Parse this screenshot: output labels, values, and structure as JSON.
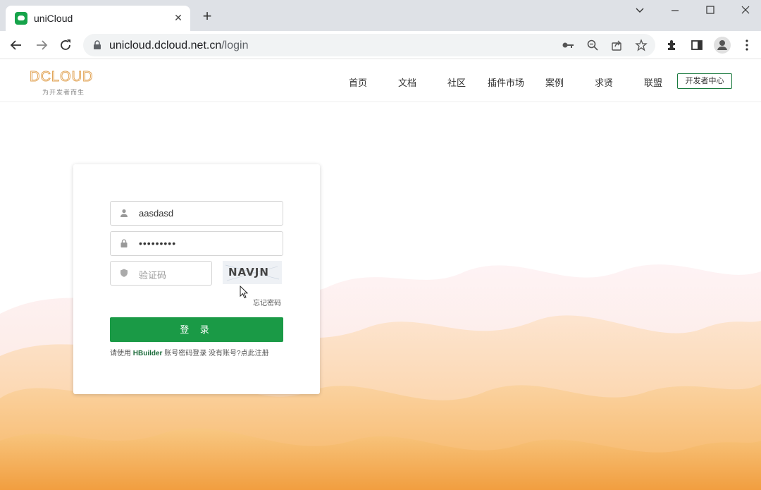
{
  "browser": {
    "tab_title": "uniCloud",
    "tab_close": "✕",
    "new_tab": "+",
    "url_host": "unicloud.dcloud.net.cn",
    "url_path": "/login"
  },
  "header": {
    "logo_text": "DCLOUD",
    "slogan": "为开发者而生",
    "nav": [
      "首页",
      "文档",
      "社区",
      "插件市场",
      "案例",
      "求贤",
      "联盟"
    ],
    "dev_center": "开发者中心"
  },
  "login": {
    "username_value": "aasdasd",
    "password_dots": "•••••••••",
    "captcha_placeholder": "验证码",
    "captcha_text": "NAVJN",
    "forgot": "忘记密码",
    "submit": "登 录",
    "hint_prefix": "请使用",
    "hint_brand": "HBuilder",
    "hint_mid": "账号密码登录 没有账号?",
    "hint_link": "点此注册"
  },
  "colors": {
    "accent": "#1a9a46",
    "tabstrip": "#dee1e6"
  }
}
